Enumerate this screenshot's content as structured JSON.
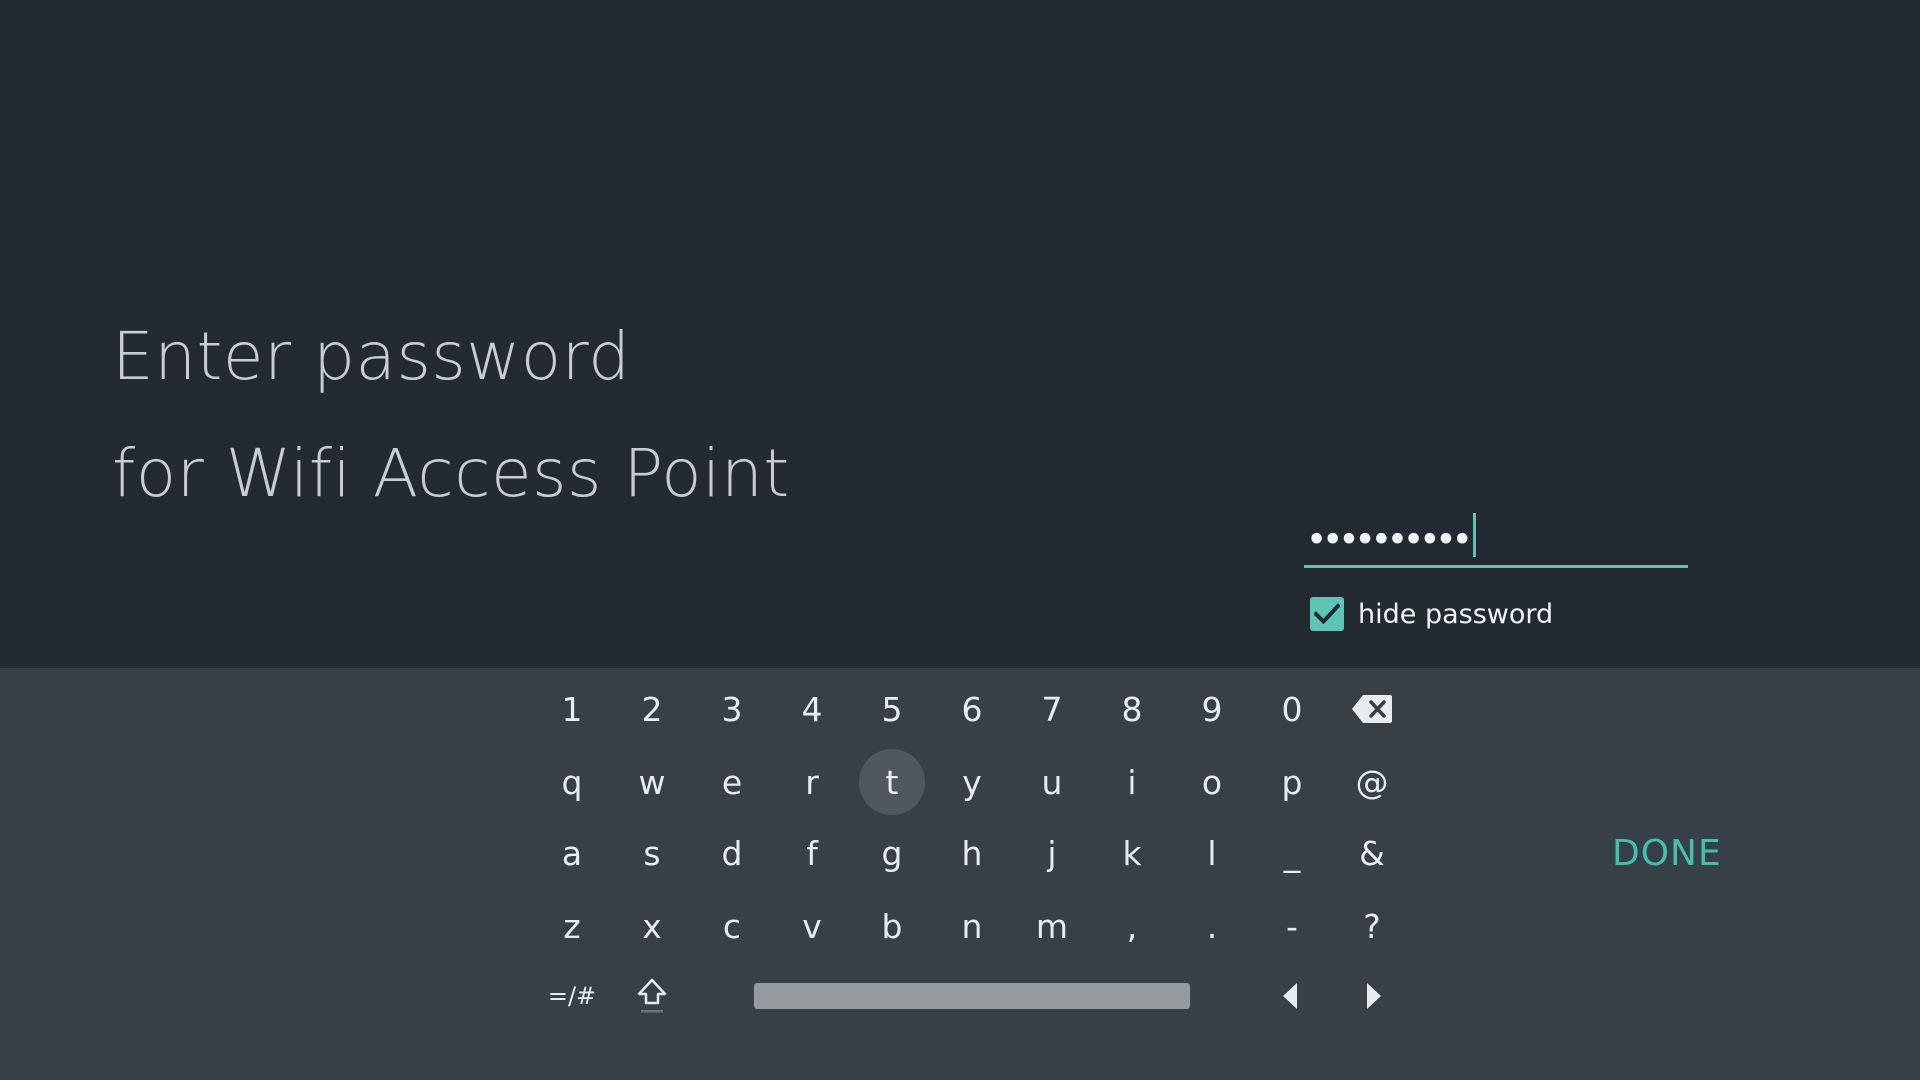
{
  "prompt": {
    "line1": "Enter password",
    "line2": "for Wifi Access Point"
  },
  "password_field": {
    "masked_value": "••••••••••"
  },
  "hide_password": {
    "label": "hide password",
    "checked": true
  },
  "keyboard": {
    "row1": [
      "1",
      "2",
      "3",
      "4",
      "5",
      "6",
      "7",
      "8",
      "9",
      "0"
    ],
    "row2": [
      "q",
      "w",
      "e",
      "r",
      "t",
      "y",
      "u",
      "i",
      "o",
      "p",
      "@"
    ],
    "row3": [
      "a",
      "s",
      "d",
      "f",
      "g",
      "h",
      "j",
      "k",
      "l",
      "_",
      "&"
    ],
    "row4": [
      "z",
      "x",
      "c",
      "v",
      "b",
      "n",
      "m",
      ",",
      ".",
      "-",
      "?"
    ],
    "symbols_label": "=/#",
    "focused_key": "t",
    "done_label": "DONE"
  },
  "colors": {
    "background": "#232a31",
    "keyboard_background": "#373f47",
    "accent": "#5dc5b6",
    "done": "#43bfae",
    "focused_key": "#50575e"
  },
  "icons": {
    "backspace": "backspace-icon",
    "shift": "shift-icon",
    "left": "cursor-left-icon",
    "right": "cursor-right-icon",
    "check": "checkmark-icon"
  }
}
